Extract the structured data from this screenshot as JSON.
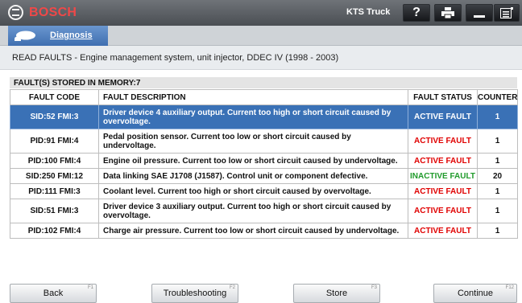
{
  "titlebar": {
    "brand": "BOSCH",
    "app_name": "KTS Truck",
    "buttons": [
      {
        "name": "help-button",
        "icon": "help-icon",
        "glyph": "?"
      },
      {
        "name": "print-button",
        "icon": "print-icon",
        "glyph": "⎙"
      },
      {
        "name": "minimize-button",
        "icon": "minimize-icon",
        "glyph": "—"
      },
      {
        "name": "menu-button",
        "icon": "list-menu-icon",
        "glyph": "☰"
      }
    ]
  },
  "tabbar": {
    "tab_label": "Diagnosis",
    "tab_icon": "vehicle-icon"
  },
  "heading": "READ FAULTS - Engine management system, unit injector, DDEC IV (1998 - 2003)",
  "faults": {
    "stored_label": "FAULT(S) STORED IN MEMORY:7",
    "columns": [
      "FAULT CODE",
      "FAULT DESCRIPTION",
      "FAULT STATUS",
      "COUNTER"
    ],
    "rows": [
      {
        "code": "SID:52 FMI:3",
        "description": "Driver device 4 auxiliary output. Current too high or short circuit caused by overvoltage.",
        "status": "ACTIVE FAULT",
        "counter": "1",
        "selected": true
      },
      {
        "code": "PID:91 FMI:4",
        "description": "Pedal position sensor. Current too low or short circuit caused by undervoltage.",
        "status": "ACTIVE FAULT",
        "counter": "1"
      },
      {
        "code": "PID:100 FMI:4",
        "description": "Engine oil pressure. Current too low or short circuit caused by undervoltage.",
        "status": "ACTIVE FAULT",
        "counter": "1"
      },
      {
        "code": "SID:250 FMI:12",
        "description": "Data linking SAE J1708 (J1587). Control unit or component defective.",
        "status": "INACTIVE FAULT",
        "counter": "20"
      },
      {
        "code": "PID:111 FMI:3",
        "description": "Coolant level. Current too high or short circuit caused by overvoltage.",
        "status": "ACTIVE FAULT",
        "counter": "1"
      },
      {
        "code": "SID:51 FMI:3",
        "description": "Driver device 3 auxiliary output. Current too high or short circuit caused by overvoltage.",
        "status": "ACTIVE FAULT",
        "counter": "1"
      },
      {
        "code": "PID:102 FMI:4",
        "description": "Charge air pressure. Current too low or short circuit caused by undervoltage.",
        "status": "ACTIVE FAULT",
        "counter": "1"
      }
    ]
  },
  "footer": {
    "back": {
      "label": "Back",
      "fkey": "F1"
    },
    "troubleshooting": {
      "label": "Troubleshooting",
      "fkey": "F2"
    },
    "store": {
      "label": "Store",
      "fkey": "F3"
    },
    "continue": {
      "label": "Continue",
      "fkey": "F12"
    }
  },
  "colors": {
    "selection": "#3a71b6",
    "active_fault": "#e00000",
    "inactive_fault": "#1f9a2a",
    "brand": "#f04848"
  }
}
